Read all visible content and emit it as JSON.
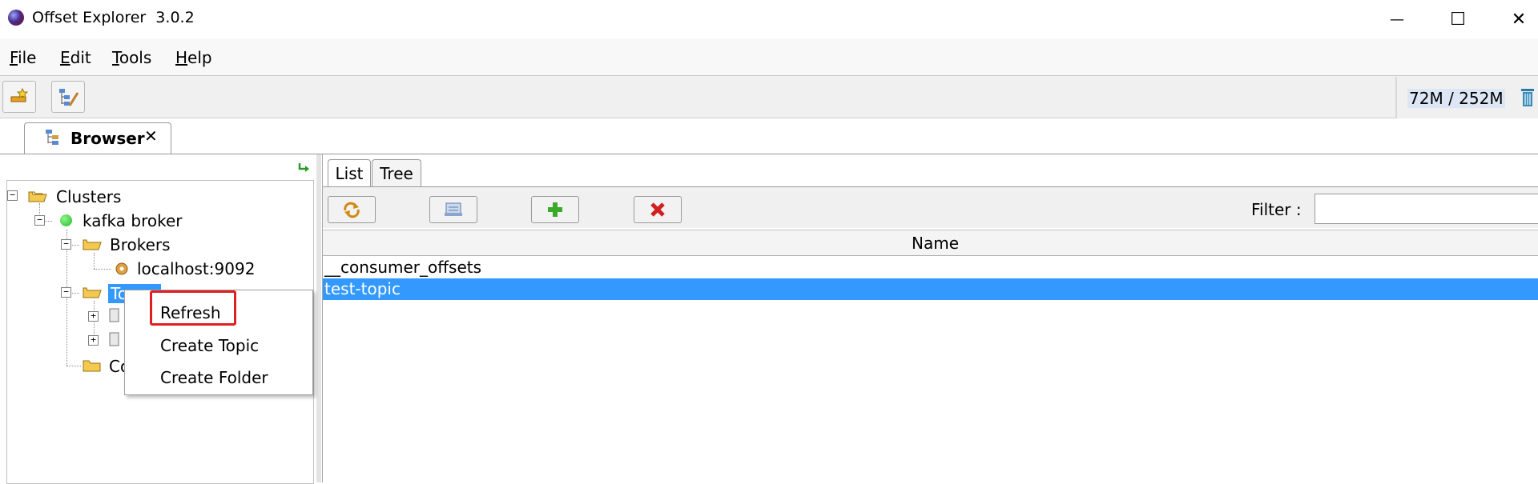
{
  "window": {
    "title": "Offset Explorer  3.0.2",
    "controls": {
      "minimize": "—",
      "maximize": "☐",
      "close": "✕"
    }
  },
  "menu": [
    "File",
    "Edit",
    "Tools",
    "Help"
  ],
  "menu_mnemonics": [
    "F",
    "E",
    "T",
    "H"
  ],
  "toolbar": {
    "memory": "72M / 252M"
  },
  "tabs": {
    "browser": "Browser",
    "close": "✕"
  },
  "tree": {
    "root": "Clusters",
    "cluster": "kafka broker",
    "brokers": "Brokers",
    "broker_host": "localhost:9092",
    "topics_partial": "To",
    "consumers_partial": "Co"
  },
  "context_menu": [
    "Refresh",
    "Create Topic",
    "Create Folder"
  ],
  "right": {
    "subtabs": [
      "List",
      "Tree"
    ],
    "filter_label": "Filter :",
    "filter_value": "",
    "column": "Name",
    "rows": [
      "__consumer_offsets",
      "test-topic"
    ],
    "selected_row": 1
  },
  "colors": {
    "selection": "#3399ff",
    "context_highlight": "#e02020",
    "status_green": "#22bb22"
  }
}
